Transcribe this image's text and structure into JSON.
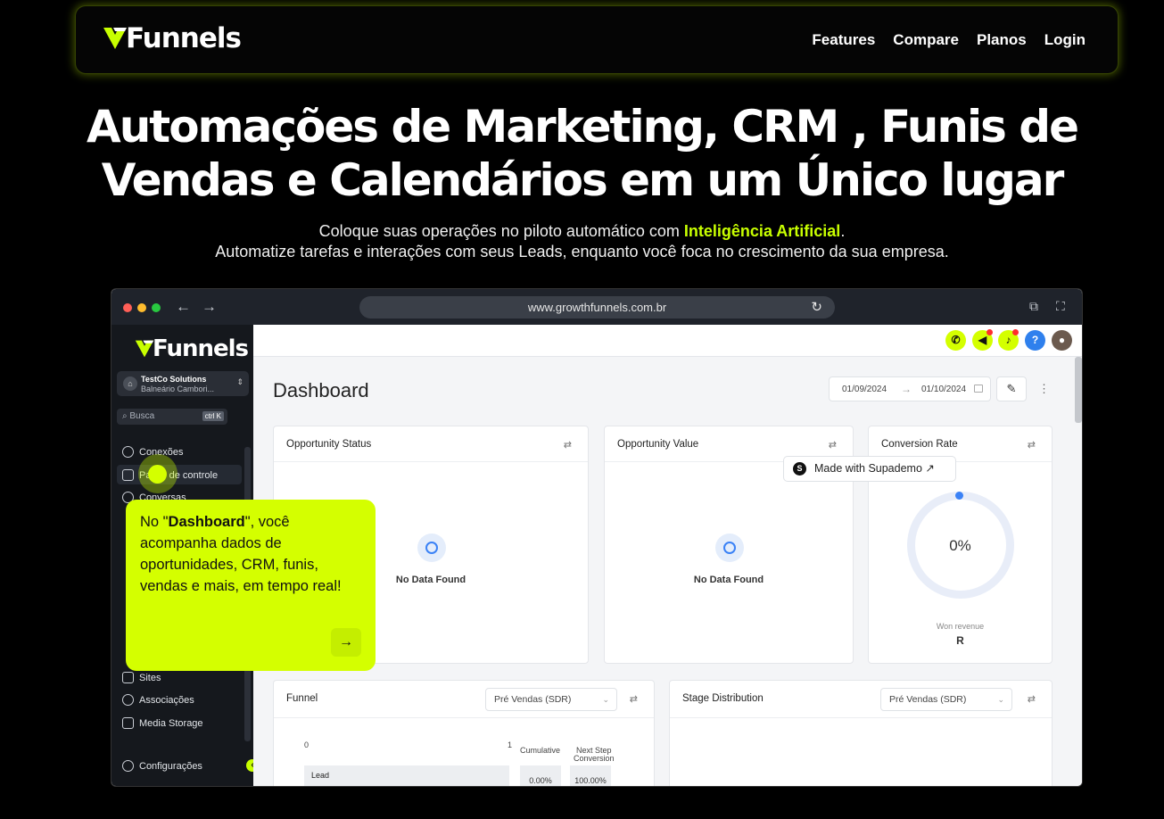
{
  "nav": {
    "brand": "Funnels",
    "links": [
      "Features",
      "Compare",
      "Planos",
      "Login"
    ]
  },
  "hero": {
    "title_line1": "Automações de Marketing, CRM , Funis de",
    "title_line2": "Vendas e Calendários em um Único lugar",
    "sub_line1_pre": "Coloque suas operações no piloto automático com ",
    "sub_line1_hl": "Inteligência Artificial",
    "sub_line1_post": ".",
    "sub_line2": "Automatize tarefas e interações com seus Leads, enquanto você foca no crescimento da sua empresa."
  },
  "browser": {
    "url": "www.growthfunnels.com.br"
  },
  "sidebar": {
    "brand": "Funnels",
    "company_name": "TestCo Solutions",
    "company_location": "Balneário Cambori...",
    "search_placeholder": "Busca",
    "search_shortcut": "ctrl K",
    "items": [
      "Conexões",
      "Painel de controle",
      "Conversas",
      "Sites",
      "Associações",
      "Media Storage",
      "Configurações"
    ]
  },
  "tooltip": {
    "pre": "No \"",
    "bold": "Dashboard",
    "post": "\", você acompanha dados de oportunidades, CRM, funis, vendas e mais, em tempo real!"
  },
  "dashboard": {
    "title": "Dashboard",
    "date_from": "01/09/2024",
    "date_to": "01/10/2024",
    "cards": {
      "opportunity_status": {
        "title": "Opportunity Status",
        "empty": "No Data Found"
      },
      "opportunity_value": {
        "title": "Opportunity Value",
        "empty": "No Data Found"
      },
      "conversion_rate": {
        "title": "Conversion Rate",
        "value": "0%",
        "won_label": "Won revenue",
        "won_value": "R"
      },
      "funnel": {
        "title": "Funnel",
        "select": "Pré Vendas (SDR)",
        "axis_start": "0",
        "axis_end": "1",
        "col_cumulative": "Cumulative",
        "col_next_step_1": "Next Step",
        "col_next_step_2": "Conversion",
        "row_label": "Lead",
        "cumulative_value": "0.00%",
        "next_step_value": "100.00%"
      },
      "stage_distribution": {
        "title": "Stage Distribution",
        "select": "Pré Vendas (SDR)"
      }
    }
  },
  "supademo": {
    "label": "Made with Supademo"
  },
  "colors": {
    "accent": "#c8ff00",
    "brand_blue": "#3b82f6"
  }
}
